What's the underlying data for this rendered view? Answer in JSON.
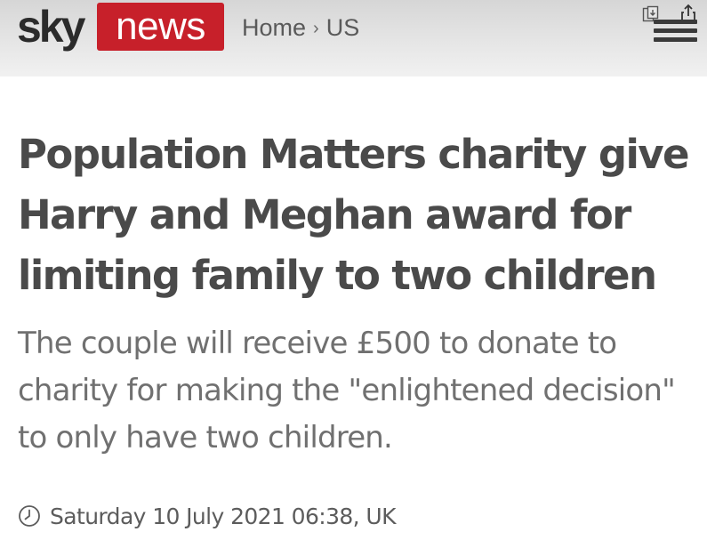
{
  "header": {
    "logo_sky": "sky",
    "logo_news": "news",
    "breadcrumb": {
      "home": "Home",
      "separator": "›",
      "current": "US"
    },
    "icons": [
      "copy-icon",
      "share-icon",
      "menu-icon"
    ],
    "brand_red": "#c7202a"
  },
  "article": {
    "headline": "Population Matters charity give Harry and Meghan award for limiting family to two children",
    "standfirst": "The couple will receive £500 to donate to charity for making the \"enlightened decision\" to only have two children.",
    "timestamp": "Saturday 10 July 2021 06:38, UK",
    "timestamp_icon": "clock-icon"
  }
}
